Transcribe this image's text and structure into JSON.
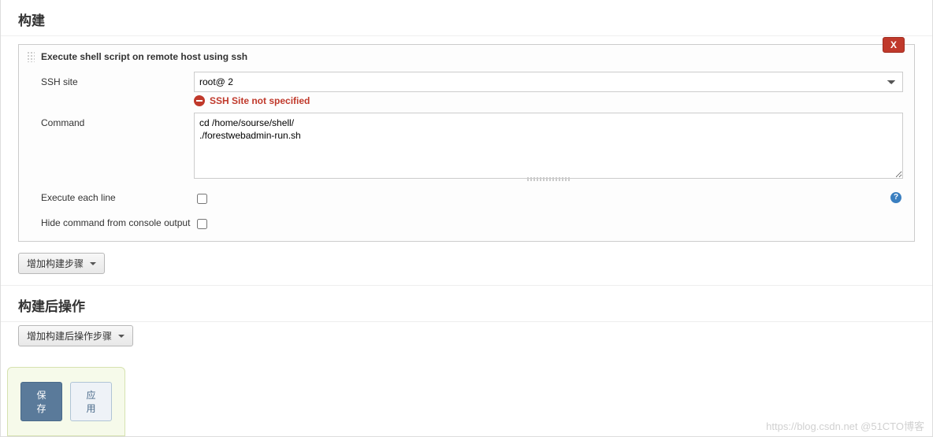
{
  "sections": {
    "build_title": "构建",
    "postbuild_title": "构建后操作"
  },
  "step": {
    "title": "Execute shell script on remote host using ssh",
    "close_label": "X",
    "ssh_label": "SSH site",
    "ssh_value": "root@                                     2",
    "ssh_error": "SSH Site not specified",
    "command_label": "Command",
    "command_value": "cd /home/sourse/shell/\n./forestwebadmin-run.sh",
    "exec_each_label": "Execute each line",
    "hide_cmd_label": "Hide command from console output"
  },
  "buttons": {
    "add_build_step": "增加构建步骤",
    "add_postbuild_step": "增加构建后操作步骤",
    "save": "保存",
    "apply": "应用"
  },
  "watermark": "https://blog.csdn.net @51CTO博客"
}
